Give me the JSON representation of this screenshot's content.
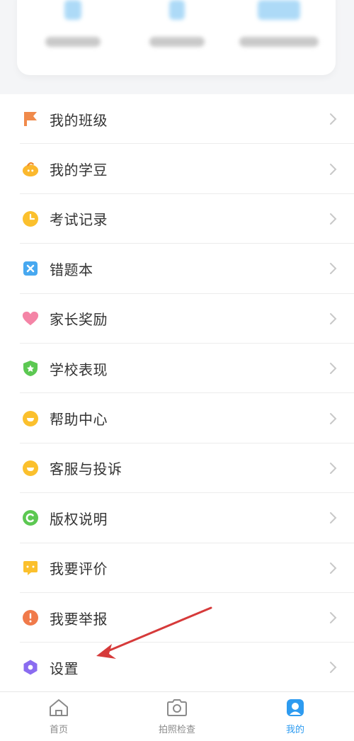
{
  "menu": {
    "items": [
      {
        "label": "我的班级",
        "icon": "flag-icon",
        "color": "#f08a4b"
      },
      {
        "label": "我的学豆",
        "icon": "bean-icon",
        "color": "#fbb82d"
      },
      {
        "label": "考试记录",
        "icon": "clock-icon",
        "color": "#fbc02d"
      },
      {
        "label": "错题本",
        "icon": "error-book-icon",
        "color": "#47a8f0"
      },
      {
        "label": "家长奖励",
        "icon": "heart-icon",
        "color": "#f484a6"
      },
      {
        "label": "学校表现",
        "icon": "shield-star-icon",
        "color": "#5cc852"
      },
      {
        "label": "帮助中心",
        "icon": "help-icon",
        "color": "#fbc02d"
      },
      {
        "label": "客服与投诉",
        "icon": "service-icon",
        "color": "#fbc02d"
      },
      {
        "label": "版权说明",
        "icon": "copyright-icon",
        "color": "#5cc852"
      },
      {
        "label": "我要评价",
        "icon": "comment-icon",
        "color": "#fbc02d"
      },
      {
        "label": "我要举报",
        "icon": "report-icon",
        "color": "#f07a4a"
      },
      {
        "label": "设置",
        "icon": "settings-icon",
        "color": "#8a6cf0"
      }
    ]
  },
  "bottom_nav": {
    "tabs": [
      {
        "label": "首页",
        "icon": "home-icon"
      },
      {
        "label": "拍照检查",
        "icon": "camera-icon"
      },
      {
        "label": "我的",
        "icon": "profile-icon",
        "active": true
      }
    ]
  },
  "colors": {
    "accent": "#2d9bf0",
    "annotation_arrow": "#d63a3a"
  }
}
